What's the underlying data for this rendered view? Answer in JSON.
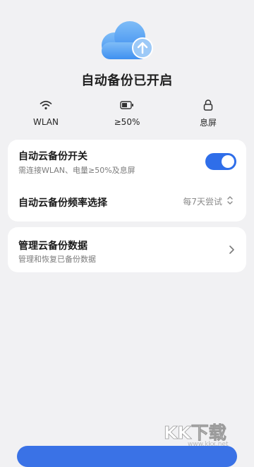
{
  "hero": {
    "title": "自动备份已开启",
    "icon": "cloud-upload-icon",
    "accent": "#4a9af3"
  },
  "conditions": [
    {
      "icon": "wifi-icon",
      "label": "WLAN"
    },
    {
      "icon": "battery-icon",
      "label": "≥50%"
    },
    {
      "icon": "lock-icon",
      "label": "息屏"
    }
  ],
  "settings": {
    "auto_backup": {
      "title": "自动云备份开关",
      "subtitle": "需连接WLAN、电量≥50%及息屏",
      "enabled": true,
      "toggle_color": "#2f6ee9"
    },
    "frequency": {
      "title": "自动云备份频率选择",
      "value": "每7天尝试"
    }
  },
  "manage": {
    "title": "管理云备份数据",
    "subtitle": "管理和恢复已备份数据"
  },
  "watermark": {
    "text": "KK下载",
    "url": "www.kkx.net"
  }
}
